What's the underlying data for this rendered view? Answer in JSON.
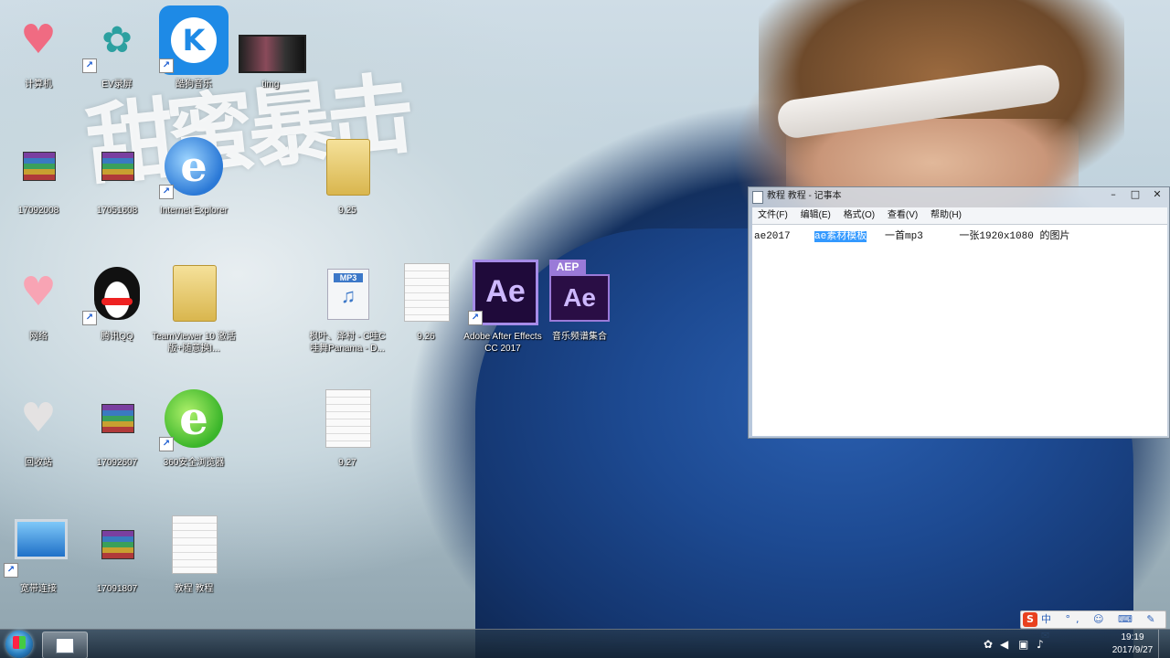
{
  "desktop": {
    "icons": [
      {
        "label": "计算机"
      },
      {
        "label": "EV录屏"
      },
      {
        "label": "酷狗音乐"
      },
      {
        "label": "timg"
      },
      {
        "label": "17092008"
      },
      {
        "label": "17051608"
      },
      {
        "label": "Internet Explorer"
      },
      {
        "label": "9.25"
      },
      {
        "label": "网络"
      },
      {
        "label": "腾讯QQ"
      },
      {
        "label": "TeamViewer 10 激活版+随意换I..."
      },
      {
        "label": "枫叶、泽村 - C哇C哇舞Panama - D..."
      },
      {
        "label": "9.26"
      },
      {
        "label": "Adobe After Effects CC 2017"
      },
      {
        "label": "音乐频谱集合"
      },
      {
        "label": "回收站"
      },
      {
        "label": "17092607"
      },
      {
        "label": "360安全浏览器"
      },
      {
        "label": "9.27"
      },
      {
        "label": "宽带连接"
      },
      {
        "label": "17091807"
      },
      {
        "label": "教程 教程"
      }
    ],
    "wallpaper_text": "甜蜜暴击"
  },
  "notepad": {
    "title": "教程 教程 - 记事本",
    "controls": {
      "minimize": "–",
      "maximize": "□",
      "close": "✕"
    },
    "menu": [
      "文件(F)",
      "编辑(E)",
      "格式(O)",
      "查看(V)",
      "帮助(H)"
    ],
    "content": {
      "before": "ae2017    ",
      "selected": "ae素材模板",
      "after": "   一首mp3      一张1920x1080 的图片"
    }
  },
  "taskbar": {
    "clock_time": "19:19",
    "clock_date": "2017/9/27"
  },
  "ime": {
    "logo": "S",
    "items": "中 °, ☺ ⌨ ✎ ✉"
  },
  "colors": {
    "selection": "#3399ff",
    "shirt": "#1d4a92"
  }
}
